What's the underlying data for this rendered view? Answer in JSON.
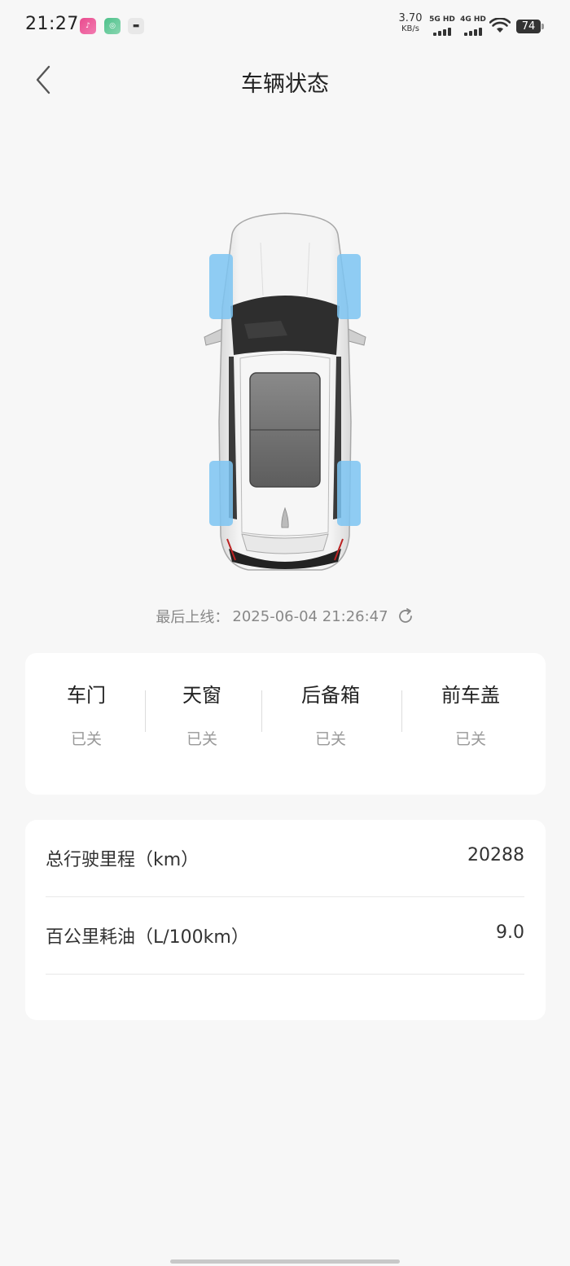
{
  "status_bar": {
    "time": "21:27",
    "network_speed": "3.70",
    "network_speed_unit": "KB/s",
    "sim1_label": "5G HD",
    "sim2_label": "4G HD",
    "battery": "74"
  },
  "header": {
    "title": "车辆状态"
  },
  "last_online": {
    "label": "最后上线：",
    "value": "2025-06-04 21:26:47"
  },
  "status_items": [
    {
      "title": "车门",
      "value": "已关"
    },
    {
      "title": "天窗",
      "value": "已关"
    },
    {
      "title": "后备箱",
      "value": "已关"
    },
    {
      "title": "前车盖",
      "value": "已关"
    }
  ],
  "info_rows": [
    {
      "label": "总行驶里程（km）",
      "value": "20288"
    },
    {
      "label": "百公里耗油（L/100km）",
      "value": "9.0"
    }
  ],
  "colors": {
    "background": "#f7f7f7",
    "card": "#ffffff",
    "tire_highlight": "#7cc4f2",
    "muted_text": "#999999"
  }
}
